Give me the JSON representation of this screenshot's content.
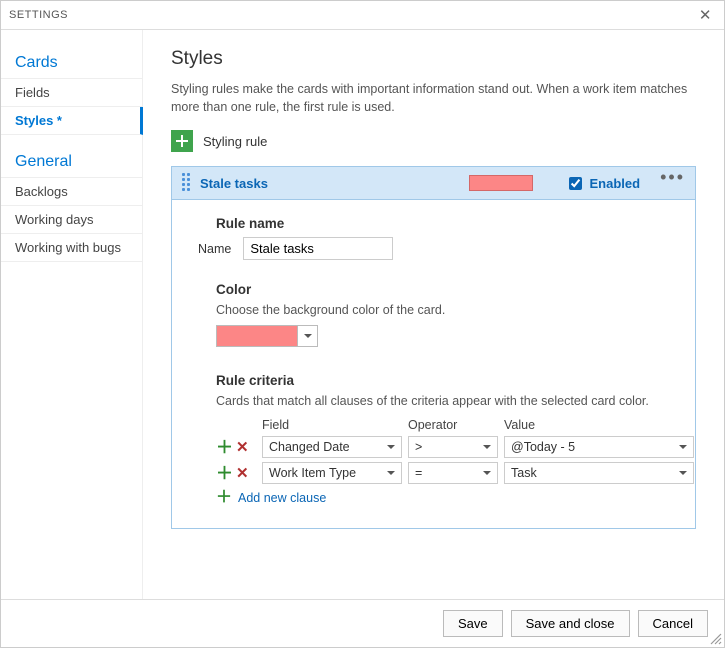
{
  "titlebar": {
    "title": "SETTINGS"
  },
  "sidebar": {
    "sections": [
      {
        "title": "Cards",
        "items": [
          {
            "label": "Fields",
            "active": false
          },
          {
            "label": "Styles *",
            "active": true
          }
        ]
      },
      {
        "title": "General",
        "items": [
          {
            "label": "Backlogs",
            "active": false
          },
          {
            "label": "Working days",
            "active": false
          },
          {
            "label": "Working with bugs",
            "active": false
          }
        ]
      }
    ]
  },
  "main": {
    "heading": "Styles",
    "lead": "Styling rules make the cards with important information stand out. When a work item matches more than one rule, the first rule is used.",
    "add_rule_label": "Styling rule",
    "rule": {
      "title": "Stale tasks",
      "swatch_color": "#fc8686",
      "enabled_label": "Enabled",
      "enabled_checked": true,
      "sections": {
        "rule_name_heading": "Rule name",
        "name_label": "Name",
        "name_value": "Stale tasks",
        "color_heading": "Color",
        "color_sub": "Choose the background color of the card.",
        "criteria_heading": "Rule criteria",
        "criteria_sub": "Cards that match all clauses of the criteria appear with the selected card color.",
        "columns": {
          "field": "Field",
          "operator": "Operator",
          "value": "Value"
        },
        "clauses": [
          {
            "field": "Changed Date",
            "operator": ">",
            "value": "@Today - 5"
          },
          {
            "field": "Work Item Type",
            "operator": "=",
            "value": "Task"
          }
        ],
        "add_clause_label": "Add new clause"
      }
    }
  },
  "footer": {
    "save": "Save",
    "save_close": "Save and close",
    "cancel": "Cancel"
  }
}
